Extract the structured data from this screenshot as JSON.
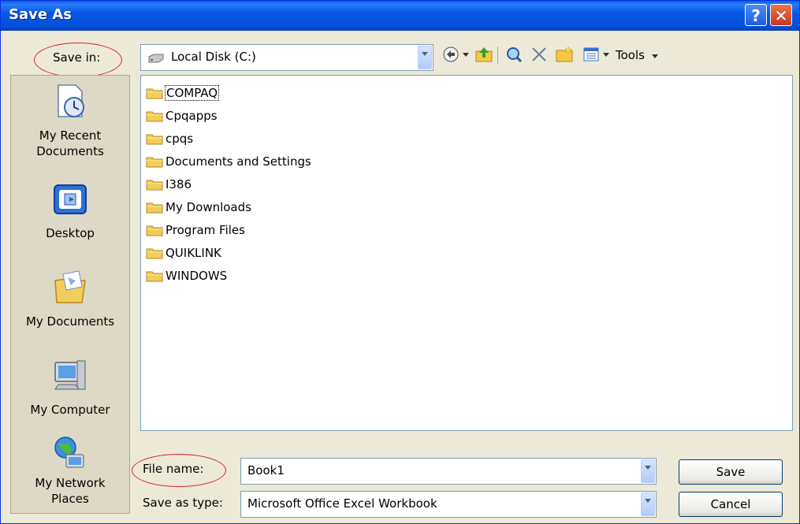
{
  "window": {
    "title": "Save As",
    "help_label": "?",
    "close_label": "✕"
  },
  "save_in": {
    "label": "Save in:",
    "value": "Local Disk (C:)"
  },
  "toolbar": {
    "tools_label": "Tools"
  },
  "places": [
    {
      "label_line1": "My Recent",
      "label_line2": "Documents",
      "icon": "recent-documents-icon"
    },
    {
      "label_line1": "Desktop",
      "label_line2": "",
      "icon": "desktop-icon"
    },
    {
      "label_line1": "My Documents",
      "label_line2": "",
      "icon": "my-documents-icon"
    },
    {
      "label_line1": "My Computer",
      "label_line2": "",
      "icon": "my-computer-icon"
    },
    {
      "label_line1": "My Network",
      "label_line2": "Places",
      "icon": "network-places-icon"
    }
  ],
  "files": [
    {
      "name": "COMPAQ"
    },
    {
      "name": "Cpqapps"
    },
    {
      "name": "cpqs"
    },
    {
      "name": "Documents and Settings"
    },
    {
      "name": "I386"
    },
    {
      "name": "My Downloads"
    },
    {
      "name": "Program Files"
    },
    {
      "name": "QUIKLINK"
    },
    {
      "name": "WINDOWS"
    }
  ],
  "file_name": {
    "label": "File name:",
    "value": "Book1"
  },
  "save_as_type": {
    "label": "Save as type:",
    "value": "Microsoft Office Excel Workbook"
  },
  "buttons": {
    "save": "Save",
    "cancel": "Cancel"
  },
  "colors": {
    "title_bar": "#0a5be6",
    "dialog_bg": "#ece9d8",
    "annotation": "#d8202a"
  }
}
